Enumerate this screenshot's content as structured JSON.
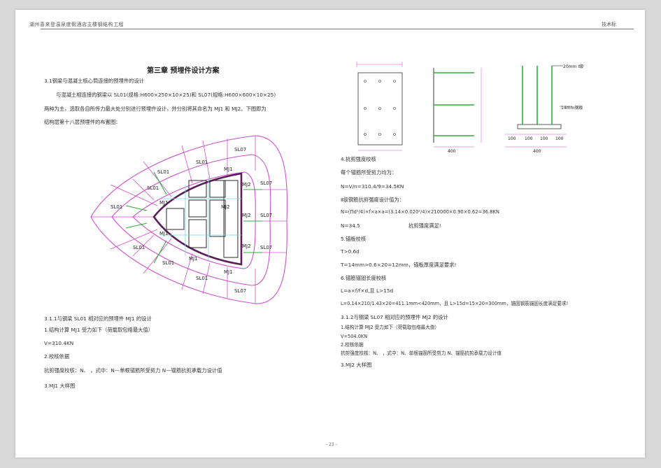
{
  "header": {
    "left": "湖州喜来登温泉度假酒店主楼钢结构工程",
    "right": "技术标"
  },
  "title": "第三章 预埋件设计方案",
  "left_col": {
    "s31": "3.1钢梁与混凝土核心筒连接的预埋件的设计",
    "p1": "与混凝土相连接的钢梁以 SL01(规格:H600×250×10×25)和 SL07(规格:H600×600×10×25)",
    "p2": "两种为主，选取各自所传力最大处分别进行预埋件设计，并分别将其命名为 MJ1 和 MJ2。下图即为",
    "p3": "结构层第十八层预埋件的布置图：",
    "s311": "3.1.1与钢梁 SL01 相对应的预埋件 MJ1 的设计",
    "item1": "1.结构计算 MJ1 受力如下（荷载取包络最大值）",
    "v": "V=310.4KN",
    "item2": "2.校核依据",
    "item2b": "抗剪强度校核：N、 ，式中：N—单根锚筋所受剪力 N—锚筋抗剪承载力设计值",
    "item3": "3.MJ1 大样图"
  },
  "right_col": {
    "item4": "4.抗剪强度校核",
    "eq1": "每个锚筋所受剪力均为：",
    "eq2": "N=V/n=310.4/9=34.5KN",
    "eq3": "Ⅱ级钢筋抗剪强度设计值为：",
    "eq4": "N=(Πd²/4)×f×a×a=(3.14×0.020²/4)×210000×0.90×0.62=36.8KN",
    "eq5a": "N=34.5",
    "eq5b": "抗剪强度满足!",
    "item5": "5.锚板校核",
    "eq6": "T>0.6d",
    "eq7": "T=14mm>0.6×20=12mm，锚板厚度满足要求!",
    "item6": "6.锚筋锚固长度校核",
    "eq8": "L=a×f/f×d,且 L>15d",
    "eq9": "L=0.14×210/1.43×20=411.1mm<420mm，且 L>15d=15×20=300mm，锚固钢筋锚固长度满足要求!",
    "s312": "3.1.2与钢梁 SL07 相对应的预埋件 MJ2 的设计",
    "m1": "1.结构计算 MJ2 受力如下（荷载取包络最大值）",
    "m2": "V=504.0KN",
    "m3": "2.校核依据",
    "m4": "抗剪强度校核：N、 ，式中：N、单根锚筋所受剪力 N、锚筋抗剪承载力设计值",
    "m5": "3.MJ2 大样图"
  },
  "drawing": {
    "labels_sl01": [
      "SL01",
      "SL01",
      "SL01",
      "SL01",
      "SL01",
      "SL01",
      "SL01"
    ],
    "labels_sl07": [
      "SL07",
      "SL07",
      "SL07",
      "SL07",
      "SL07"
    ],
    "labels_mj1": [
      "MJ1",
      "MJ1",
      "MJ1",
      "MJ1",
      "MJ1"
    ],
    "labels_mj2": [
      "MJ2",
      "MJ2",
      "MJ2",
      "MJ2"
    ]
  },
  "detail": {
    "rebar_label": "20mm Ⅰ级钢筋",
    "plate_label": "14mm钢板",
    "dim_bottom": [
      "100",
      "100",
      "100",
      "100"
    ],
    "dim_total": "400",
    "dim_plate": "400"
  },
  "page_number": "- 23 -"
}
